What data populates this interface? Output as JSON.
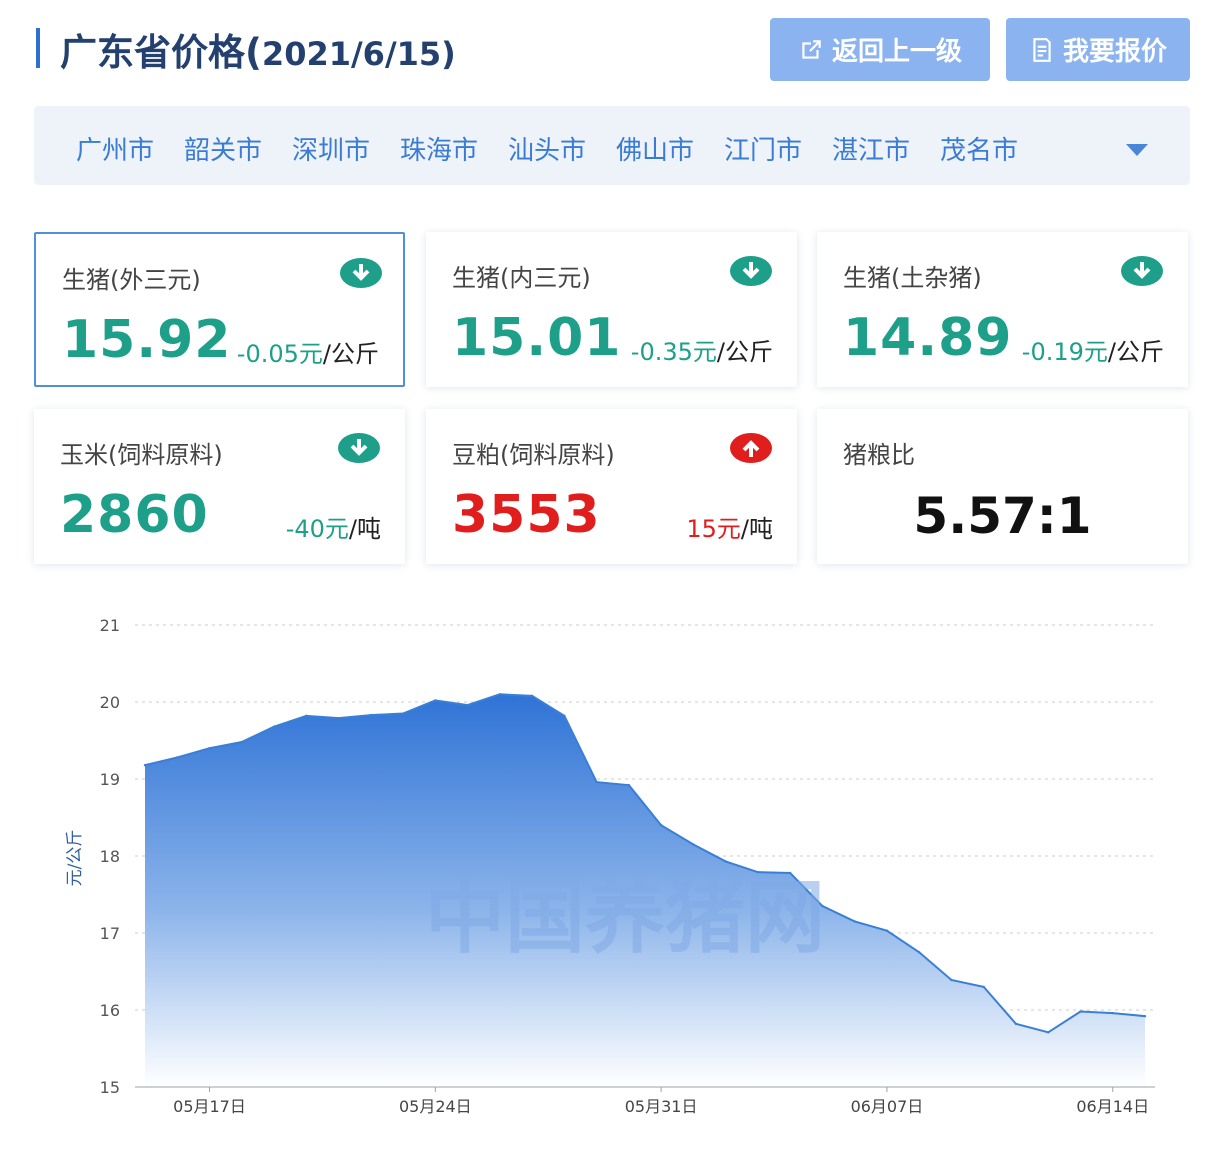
{
  "header": {
    "title": "广东省价格(",
    "date": "2021/6/15)",
    "back_label": "返回上一级",
    "quote_label": "我要报价"
  },
  "cities": {
    "items": [
      "广州市",
      "韶关市",
      "深圳市",
      "珠海市",
      "汕头市",
      "佛山市",
      "江门市",
      "湛江市",
      "茂名市"
    ],
    "dropdown_icon": "chevron-down-icon"
  },
  "cards": [
    {
      "name": "生猪(外三元)",
      "price": "15.92",
      "change": "-0.05元",
      "unit": "/公斤",
      "direction": "down",
      "color": "#1e9f8a"
    },
    {
      "name": "生猪(内三元)",
      "price": "15.01",
      "change": "-0.35元",
      "unit": "/公斤",
      "direction": "down",
      "color": "#1e9f8a"
    },
    {
      "name": "生猪(土杂猪)",
      "price": "14.89",
      "change": "-0.19元",
      "unit": "/公斤",
      "direction": "down",
      "color": "#1e9f8a"
    },
    {
      "name": "玉米(饲料原料)",
      "price": "2860",
      "change": "-40元",
      "unit": "/吨",
      "direction": "down",
      "color": "#1e9f8a"
    },
    {
      "name": "豆粕(饲料原料)",
      "price": "3553",
      "change": "15元",
      "unit": "/吨",
      "direction": "up",
      "color": "#e01e1e"
    },
    {
      "name": "猪粮比",
      "ratio": "5.57:1"
    }
  ],
  "chart_data": {
    "type": "area",
    "ylabel": "元/公斤",
    "ylim": [
      15,
      21
    ],
    "yticks": [
      "21",
      "20",
      "19",
      "18",
      "17",
      "16",
      "15"
    ],
    "xtick_labels": [
      "05月17日",
      "05月24日",
      "05月31日",
      "06月07日",
      "06月14日"
    ],
    "xtick_dates": [
      "05-17",
      "05-24",
      "05-31",
      "06-07",
      "06-14"
    ],
    "x": [
      "05-15",
      "05-16",
      "05-17",
      "05-18",
      "05-19",
      "05-20",
      "05-21",
      "05-22",
      "05-23",
      "05-24",
      "05-25",
      "05-26",
      "05-27",
      "05-28",
      "05-29",
      "05-30",
      "05-31",
      "06-01",
      "06-02",
      "06-03",
      "06-04",
      "06-05",
      "06-06",
      "06-07",
      "06-08",
      "06-09",
      "06-10",
      "06-11",
      "06-12",
      "06-13",
      "06-14",
      "06-15"
    ],
    "values": [
      19.18,
      19.28,
      19.4,
      19.48,
      19.68,
      19.82,
      19.79,
      19.83,
      19.85,
      20.02,
      19.96,
      20.1,
      20.08,
      19.82,
      18.96,
      18.92,
      18.4,
      18.15,
      17.93,
      17.79,
      17.78,
      17.35,
      17.15,
      17.03,
      16.75,
      16.39,
      16.3,
      15.82,
      15.71,
      15.98,
      15.96,
      15.92
    ],
    "grid": true,
    "line_color": "#3a7fd6",
    "watermark": "中国养猪网"
  }
}
